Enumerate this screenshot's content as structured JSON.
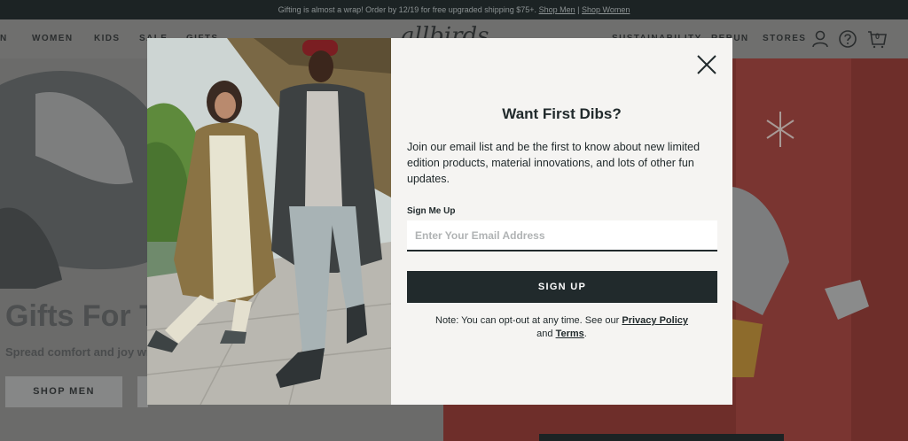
{
  "announcement": {
    "text": "Gifting is almost a wrap! Order by 12/19 for free upgraded shipping $75+.",
    "link_men": "Shop Men",
    "separator": "|",
    "link_women": "Shop Women"
  },
  "nav": {
    "logo": "allbirds",
    "left_items": [
      "N",
      "WOMEN",
      "KIDS",
      "SALE",
      "GIFTS"
    ],
    "right_items": [
      "SUSTAINABILITY",
      "REBUN",
      "STORES"
    ],
    "cart_count": "0"
  },
  "hero": {
    "title": "Gifts For T",
    "subtitle": "Spread comfort and joy wit",
    "button_men": "SHOP MEN"
  },
  "modal": {
    "title": "Want First Dibs?",
    "description": "Join our email list and be the first to know about new limited edition products, material innovations, and lots of other fun updates.",
    "field_label": "Sign Me Up",
    "email_placeholder": "Enter Your Email Address",
    "email_value": "",
    "submit_label": "SIGN UP",
    "note_prefix": "Note: You can opt-out at any time. See our",
    "privacy_link": "Privacy Policy",
    "note_and": "and",
    "terms_link": "Terms",
    "note_suffix": "."
  },
  "colors": {
    "modal_bg": "#f5f4f2",
    "dark": "#212a2c",
    "overlay_bar": "#1c2324"
  }
}
